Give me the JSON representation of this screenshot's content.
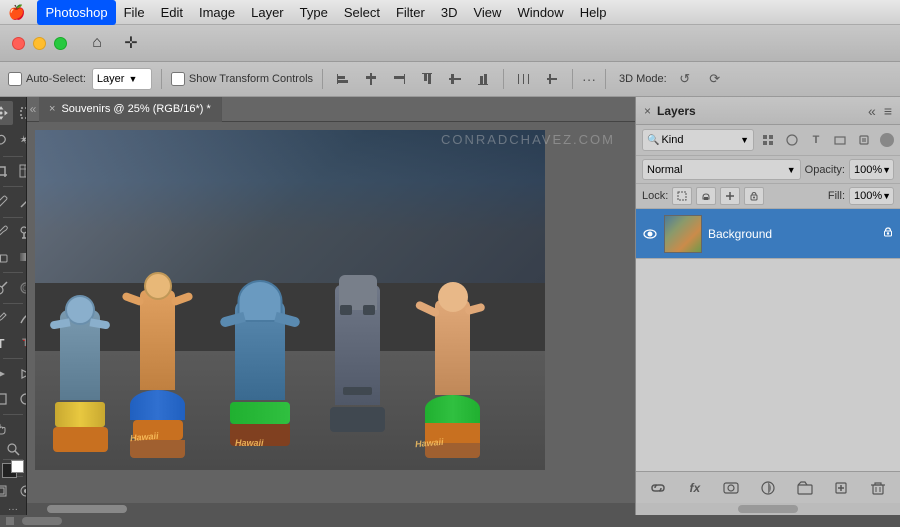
{
  "menubar": {
    "apple": "🍎",
    "items": [
      "Photoshop",
      "File",
      "Edit",
      "Image",
      "Layer",
      "Type",
      "Select",
      "Filter",
      "3D",
      "View",
      "Window",
      "Help"
    ]
  },
  "titlebar": {
    "buttons": [
      "close",
      "minimize",
      "maximize"
    ]
  },
  "optionsbar": {
    "autoselect_label": "Auto-Select:",
    "autoselect_value": "Layer",
    "transform_checkbox": false,
    "transform_label": "Show Transform Controls",
    "mode_label": "3D Mode:",
    "more_icon": "···"
  },
  "toolbar": {
    "tools": [
      {
        "name": "move",
        "icon": "✛"
      },
      {
        "name": "selection",
        "icon": "⬚"
      },
      {
        "name": "lasso",
        "icon": "○"
      },
      {
        "name": "magic-wand",
        "icon": "⌖"
      },
      {
        "name": "crop",
        "icon": "⊠"
      },
      {
        "name": "eyedropper",
        "icon": "◈"
      },
      {
        "name": "brush",
        "icon": "/"
      },
      {
        "name": "clone-stamp",
        "icon": "◫"
      },
      {
        "name": "eraser",
        "icon": "◻"
      },
      {
        "name": "gradient",
        "icon": "▦"
      },
      {
        "name": "dodge",
        "icon": "⊙"
      },
      {
        "name": "pen",
        "icon": "✒"
      },
      {
        "name": "type",
        "icon": "T"
      },
      {
        "name": "path-select",
        "icon": "▸"
      },
      {
        "name": "shape",
        "icon": "⬜"
      },
      {
        "name": "hand",
        "icon": "✋"
      },
      {
        "name": "zoom",
        "icon": "🔍"
      }
    ]
  },
  "document": {
    "tab_title": "Souvenirs @ 25% (RGB/16*) *",
    "close_icon": "×",
    "watermark": "CONRADCHAVEZ.COM"
  },
  "layers_panel": {
    "header": {
      "title": "Layers",
      "close_icon": "«"
    },
    "kind_label": "Kind",
    "blend_mode": "Normal",
    "opacity_label": "Opacity:",
    "opacity_value": "100%",
    "lock_label": "Lock:",
    "fill_label": "Fill:",
    "fill_value": "100%",
    "layer": {
      "name": "Background",
      "visible": true
    },
    "footer_icons": [
      "link",
      "fx",
      "mask",
      "adjustment",
      "folder",
      "new-layer",
      "delete"
    ]
  }
}
